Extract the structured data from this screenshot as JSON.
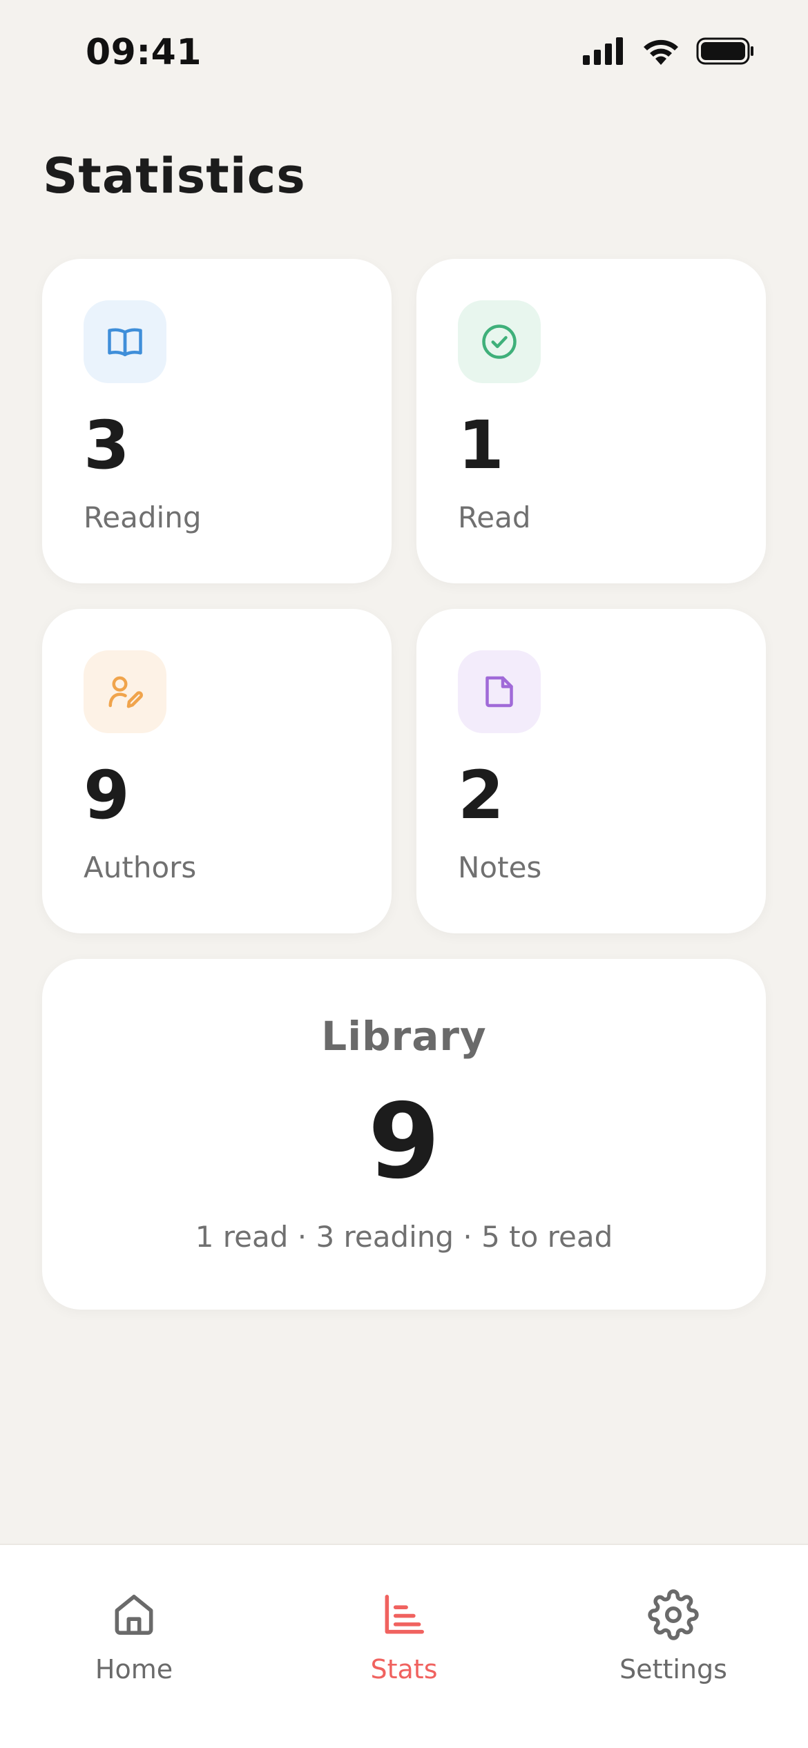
{
  "status_bar": {
    "time": "09:41"
  },
  "page": {
    "title": "Statistics"
  },
  "stats": [
    {
      "value": "3",
      "label": "Reading",
      "icon": "open-book-icon",
      "color": "#3f8ed9",
      "tile": "#eaf3fc"
    },
    {
      "value": "1",
      "label": "Read",
      "icon": "check-circle-icon",
      "color": "#3fb07a",
      "tile": "#e8f6ee"
    },
    {
      "value": "9",
      "label": "Authors",
      "icon": "user-edit-icon",
      "color": "#f0a44c",
      "tile": "#fdf2e6"
    },
    {
      "value": "2",
      "label": "Notes",
      "icon": "note-icon",
      "color": "#a06ad8",
      "tile": "#f3ecfb"
    }
  ],
  "library": {
    "title": "Library",
    "value": "9",
    "summary": "1 read · 3 reading · 5 to read"
  },
  "nav": {
    "items": [
      {
        "label": "Home",
        "icon": "home-icon",
        "active": false
      },
      {
        "label": "Stats",
        "icon": "bar-chart-icon",
        "active": true
      },
      {
        "label": "Settings",
        "icon": "gear-icon",
        "active": false
      }
    ],
    "active_color": "#f0625f",
    "inactive_color": "#6a6a6a"
  }
}
